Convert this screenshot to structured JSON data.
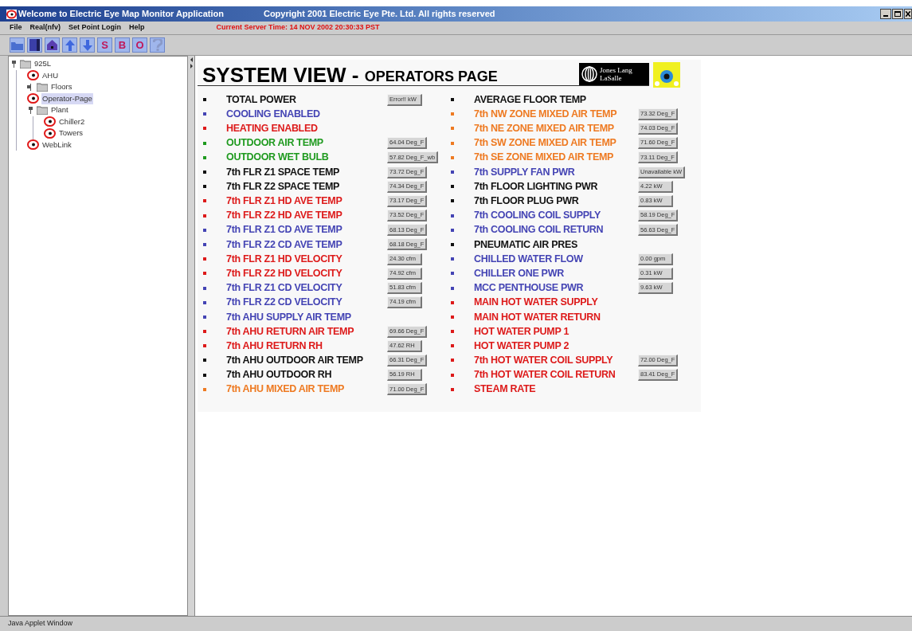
{
  "window": {
    "title": "Welcome to Electric Eye Map Monitor Application",
    "copyright": "Copyright 2001 Electric Eye Pte. Ltd. All rights reserved"
  },
  "menu": [
    "File",
    "Real(nfv)",
    "Set Point Login",
    "Help"
  ],
  "server_time": "Current Server Time: 14 NOV 2002 20:30:33 PST",
  "toolbar": [
    {
      "kind": "open"
    },
    {
      "kind": "save"
    },
    {
      "kind": "home"
    },
    {
      "kind": "up"
    },
    {
      "kind": "down"
    },
    {
      "kind": "letter",
      "glyph": "S"
    },
    {
      "kind": "letter",
      "glyph": "B"
    },
    {
      "kind": "letter",
      "glyph": "O"
    },
    {
      "kind": "help"
    }
  ],
  "tree": [
    {
      "label": "925L",
      "kind": "folder",
      "expanded": true,
      "selected": false,
      "children": [
        {
          "label": "AHU",
          "kind": "page",
          "selected": false
        },
        {
          "label": "Floors",
          "kind": "folder",
          "expanded": false,
          "selected": false
        },
        {
          "label": "Operator-Page",
          "kind": "page",
          "selected": true
        },
        {
          "label": "Plant",
          "kind": "folder",
          "expanded": true,
          "selected": false,
          "children": [
            {
              "label": "Chiller2",
              "kind": "page",
              "selected": false
            },
            {
              "label": "Towers",
              "kind": "page",
              "selected": false
            }
          ]
        },
        {
          "label": "WebLink",
          "kind": "page",
          "selected": false
        }
      ]
    }
  ],
  "page": {
    "title": "SYSTEM VIEW - ",
    "subtitle": "OPERATORS PAGE",
    "logo_text": "Jones Lang LaSalle",
    "columns": [
      [
        {
          "label": "TOTAL POWER",
          "color": "#111111",
          "value": "Error!! kW"
        },
        {
          "label": "COOLING ENABLED",
          "color": "#4444b4"
        },
        {
          "label": "HEATING ENABLED",
          "color": "#dd1a1a"
        },
        {
          "label": "OUTDOOR AIR TEMP",
          "color": "#1f9a1f",
          "value": "64.04 Deg_F"
        },
        {
          "label": "OUTDOOR WET BULB",
          "color": "#1f9a1f",
          "value": "57.82 Deg_F_wb"
        },
        {
          "label": "7th FLR Z1 SPACE TEMP",
          "color": "#111111",
          "value": "73.72 Deg_F"
        },
        {
          "label": "7th FLR Z2 SPACE TEMP",
          "color": "#111111",
          "value": "74.34 Deg_F"
        },
        {
          "label": "7th FLR Z1 HD AVE TEMP",
          "color": "#dd1a1a",
          "value": "73.17 Deg_F"
        },
        {
          "label": "7th FLR Z2 HD AVE TEMP",
          "color": "#dd1a1a",
          "value": "73.52 Deg_F"
        },
        {
          "label": "7th FLR Z1 CD AVE TEMP",
          "color": "#4444b4",
          "value": "68.13 Deg_F"
        },
        {
          "label": "7th FLR Z2 CD AVE TEMP",
          "color": "#4444b4",
          "value": "68.18 Deg_F"
        },
        {
          "label": "7th FLR Z1 HD VELOCITY",
          "color": "#dd1a1a",
          "value": "24.30 cfm"
        },
        {
          "label": "7th FLR Z2 HD VELOCITY",
          "color": "#dd1a1a",
          "value": "74.92 cfm"
        },
        {
          "label": "7th FLR Z1 CD VELOCITY",
          "color": "#4444b4",
          "value": "51.83 cfm"
        },
        {
          "label": "7th FLR Z2 CD VELOCITY",
          "color": "#4444b4",
          "value": "74.19 cfm"
        },
        {
          "label": "7th AHU SUPPLY AIR TEMP",
          "color": "#4444b4"
        },
        {
          "label": "7th AHU RETURN AIR TEMP",
          "color": "#dd1a1a",
          "value": "69.66 Deg_F"
        },
        {
          "label": "7th AHU RETURN RH",
          "color": "#dd1a1a",
          "value": "47.62 RH"
        },
        {
          "label": "7th AHU OUTDOOR AIR TEMP",
          "color": "#111111",
          "value": "66.31 Deg_F"
        },
        {
          "label": "7th AHU OUTDOOR RH",
          "color": "#111111",
          "value": "56.19 RH"
        },
        {
          "label": "7th AHU MIXED AIR TEMP",
          "color": "#ee7a22",
          "value": "71.00 Deg_F"
        }
      ],
      [
        {
          "label": "AVERAGE FLOOR TEMP",
          "color": "#111111"
        },
        {
          "label": "7th NW ZONE MIXED AIR TEMP",
          "color": "#ee7a22",
          "value": "73.32 Deg_F"
        },
        {
          "label": "7th NE ZONE MIXED AIR TEMP",
          "color": "#ee7a22",
          "value": "74.03 Deg_F"
        },
        {
          "label": "7th SW ZONE MIXED AIR TEMP",
          "color": "#ee7a22",
          "value": "71.60 Deg_F"
        },
        {
          "label": "7th SE ZONE MIXED AIR TEMP",
          "color": "#ee7a22",
          "value": "73.11 Deg_F"
        },
        {
          "label": "7th SUPPLY FAN PWR",
          "color": "#4444b4",
          "value": "Unavailable kW"
        },
        {
          "label": "7th FLOOR LIGHTING PWR",
          "color": "#111111",
          "value": "4.22 kW"
        },
        {
          "label": "7th FLOOR PLUG PWR",
          "color": "#111111",
          "value": "0.83 kW"
        },
        {
          "label": "7th COOLING COIL SUPPLY",
          "color": "#4444b4",
          "value": "58.19 Deg_F"
        },
        {
          "label": "7th COOLING COIL RETURN",
          "color": "#4444b4",
          "value": "56.63 Deg_F"
        },
        {
          "label": "PNEUMATIC AIR PRES",
          "color": "#111111"
        },
        {
          "label": "CHILLED WATER FLOW",
          "color": "#4444b4",
          "value": "0.00 gpm"
        },
        {
          "label": "CHILLER ONE PWR",
          "color": "#4444b4",
          "value": "0.31 kW"
        },
        {
          "label": "MCC PENTHOUSE PWR",
          "color": "#4444b4",
          "value": "9.63 kW"
        },
        {
          "label": "MAIN HOT WATER SUPPLY",
          "color": "#dd1a1a"
        },
        {
          "label": "MAIN HOT WATER RETURN",
          "color": "#dd1a1a"
        },
        {
          "label": "HOT WATER PUMP 1",
          "color": "#dd1a1a"
        },
        {
          "label": "HOT WATER PUMP 2",
          "color": "#dd1a1a"
        },
        {
          "label": "7th HOT WATER COIL SUPPLY",
          "color": "#dd1a1a",
          "value": "72.00 Deg_F"
        },
        {
          "label": "7th HOT WATER COIL RETURN",
          "color": "#dd1a1a",
          "value": "83.41 Deg_F"
        },
        {
          "label": "STEAM RATE",
          "color": "#dd1a1a"
        }
      ]
    ]
  },
  "status_bar": "Java Applet Window"
}
